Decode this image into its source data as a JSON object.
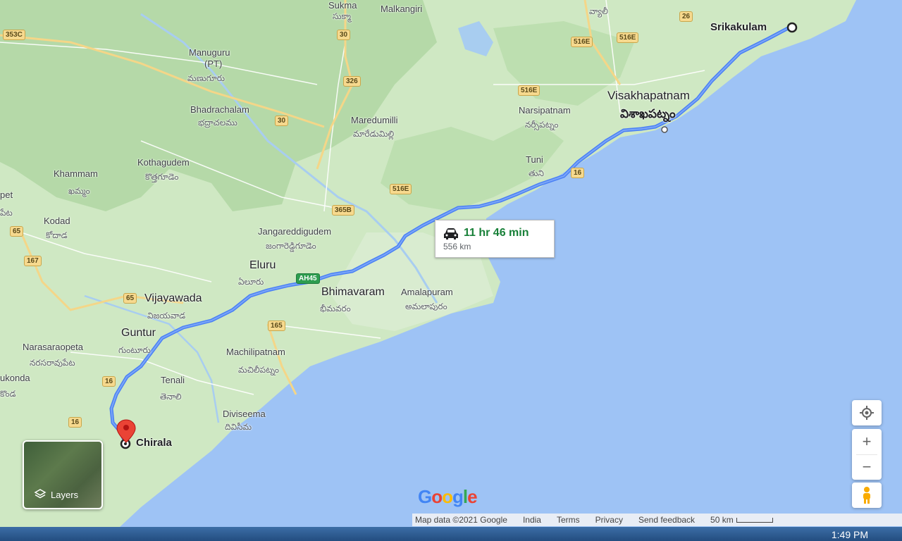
{
  "route": {
    "time": "11 hr 46 min",
    "distance": "556 km"
  },
  "places": {
    "sukma": "Sukma",
    "sukma_te": "సుక్మా",
    "malkangiri": "Malkangiri",
    "manuguru": "Manuguru",
    "manuguru_pt": "(PT)",
    "manuguru_te": "మణుగూరు",
    "bhadrachalam": "Bhadrachalam",
    "bhadrachalam_te": "భద్రాచలము",
    "maredumilli": "Maredumilli",
    "maredumilli_te": "మారేడుమిల్లి",
    "kothagudem": "Kothagudem",
    "kothagudem_te": "కొత్తగూడెం",
    "khammam": "Khammam",
    "khammam_te": "ఖమ్మం",
    "kodad": "Kodad",
    "kodad_te": "కోదాడ",
    "pet": "pet",
    "pet_te": "పేట",
    "jangareddigudem": "Jangareddigudem",
    "jangareddigudem_te": "జంగారెడ్డిగూడెం",
    "eluru": "Eluru",
    "eluru_te": "ఏలూరు",
    "vijayawada": "Vijayawada",
    "vijayawada_te": "విజయవాడ",
    "bhimavaram": "Bhimavaram",
    "bhimavaram_te": "భీమవరం",
    "amalapuram": "Amalapuram",
    "amalapuram_te": "అమలాపురం",
    "guntur": "Guntur",
    "guntur_te": "గుంటూరు",
    "narasaraopeta": "Narasaraopeta",
    "narasaraopeta_te": "నరసరావుపేట",
    "machilipatnam": "Machilipatnam",
    "machilipatnam_te": "మచిలీపట్నం",
    "tenali": "Tenali",
    "tenali_te": "తెనాలి",
    "ukonda": "ukonda",
    "ukonda_te": "కొండ",
    "diviseema": "Diviseema",
    "diviseema_te": "దివిసీమ",
    "chirala": "Chirala",
    "srikakulam": "Srikakulam",
    "visakhapatnam": "Visakhapatnam",
    "visakhapatnam_te": "విశాఖపట్నం",
    "narsipatnam": "Narsipatnam",
    "narsipatnam_te": "నర్సీపట్నం",
    "tuni": "Tuni",
    "tuni_te": "తుని",
    "vyalli_te": "వ్యాలీ"
  },
  "shields": {
    "s353c": "353C",
    "s30a": "30",
    "s326": "326",
    "s30b": "30",
    "s26": "26",
    "s516e_a": "516E",
    "s516e_b": "516E",
    "s516e_c": "516E",
    "s516e_d": "516E",
    "s365b": "365B",
    "s16_a": "16",
    "s16_b": "16",
    "s16_c": "16",
    "s65_a": "65",
    "s65_b": "65",
    "s167": "167",
    "s165": "165",
    "ah45": "AH45"
  },
  "controls": {
    "layers": "Layers"
  },
  "footer": {
    "map_data": "Map data ©2021 Google",
    "india": "India",
    "terms": "Terms",
    "privacy": "Privacy",
    "feedback": "Send feedback",
    "scale": "50 km"
  },
  "logo": "Google",
  "clock": "1:49 PM",
  "colors": {
    "land": "#cfe8c3",
    "forest": "#b5d9a8",
    "sea": "#9ec3f5",
    "route": "#4a80f5",
    "time": "#188038"
  },
  "icons": {
    "car": "car-icon",
    "pin": "red-pin-icon",
    "locate": "my-location-icon",
    "pegman": "pegman-icon",
    "layers": "layers-icon"
  }
}
